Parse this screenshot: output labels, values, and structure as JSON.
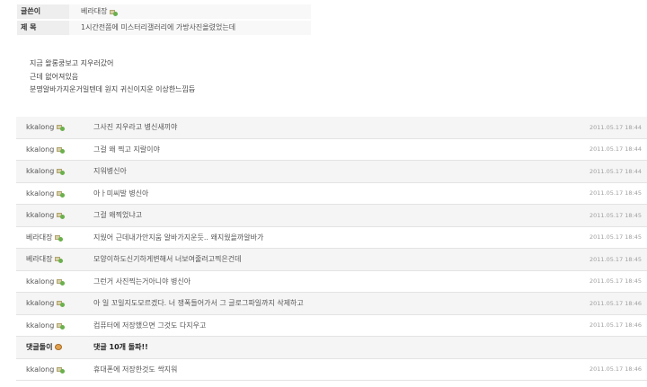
{
  "post": {
    "author_label": "글쓴이",
    "author_name": "베라대장",
    "title_label": "제 목",
    "title": "1시간전쯤에 미스터리갤러리에 가방사진올렸었는데",
    "body_lines": [
      "지금 왈롱쿵보고 지우러갔어",
      "근데 없어져있음",
      "분명알바가지운거일텐데 원지 귀신이지운 이상한느낌듬"
    ]
  },
  "comments": [
    {
      "author": "kkalong",
      "text": "그사진 지우라고 병신새끼야",
      "date": "2011.05.17 18:44",
      "icon": "user-icon"
    },
    {
      "author": "kkalong",
      "text": "그걸 왜 찍고 지랄이야",
      "date": "2011.05.17 18:44",
      "icon": "user-icon"
    },
    {
      "author": "kkalong",
      "text": "지워병신아",
      "date": "2011.05.17 18:44",
      "icon": "user-icon"
    },
    {
      "author": "kkalong",
      "text": "아ㅏ미씨발 병신아",
      "date": "2011.05.17 18:45",
      "icon": "user-icon"
    },
    {
      "author": "kkalong",
      "text": "그걸 왜찍었냐고",
      "date": "2011.05.17 18:45",
      "icon": "user-icon"
    },
    {
      "author": "베라대장",
      "text": "지웠어 근데내가안지움 알바가지운듯.. 왜지웠을까알바가",
      "date": "2011.05.17 18:45",
      "icon": "user-icon"
    },
    {
      "author": "베라대장",
      "text": "모양이하도신기하게변해서 너보여줄려고찍은건데",
      "date": "2011.05.17 18:45",
      "icon": "user-icon"
    },
    {
      "author": "kkalong",
      "text": "그런거 사진찍는거아니야 병신아",
      "date": "2011.05.17 18:45",
      "icon": "user-icon"
    },
    {
      "author": "kkalong",
      "text": "아 일 꼬일지도모르겠다. 너 쟁폭들어가서 그 글로그파일까지 삭제하고",
      "date": "2011.05.17 18:46",
      "icon": "user-icon"
    },
    {
      "author": "kkalong",
      "text": "컴퓨터에 저장했으면 그것도 다지우고",
      "date": "2011.05.17 18:46",
      "icon": "user-icon"
    },
    {
      "author": "댓글돌이",
      "text": "댓글 10개 돌파!!",
      "date": "",
      "icon": "emote-icon",
      "bold": true
    },
    {
      "author": "kkalong",
      "text": "휴대폰에 저장한것도 싹지워",
      "date": "2011.05.17 18:46",
      "icon": "user-icon"
    }
  ]
}
